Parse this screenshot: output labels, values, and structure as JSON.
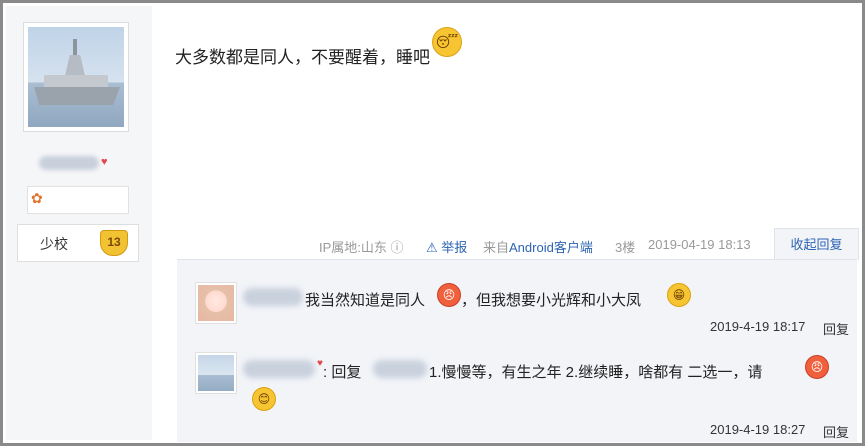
{
  "post": {
    "text": "大多数都是同人，不要醒着，睡吧",
    "ip_label": "IP属地:山东",
    "report_label": "举报",
    "client_prefix": "来自",
    "client_name": "Android客户端",
    "floor": "3楼",
    "timestamp": "2019-04-19 18:13",
    "collapse_label": "收起回复"
  },
  "user": {
    "rank_label": "少校",
    "level": "13"
  },
  "replies": [
    {
      "text_a": "我当然知道是同人",
      "text_b": "，但我想要小光辉和小大凤",
      "time": "2019-4-19 18:17",
      "reply_label": "回复"
    },
    {
      "reply_prefix": ": 回复",
      "text": "1.慢慢等，有生之年 2.继续睡，啥都有 二选一，请",
      "time": "2019-4-19 18:27",
      "reply_label": "回复"
    }
  ],
  "icons": {
    "sleep_emoji": "sleeping-face-icon",
    "help": "question-circle-icon",
    "warning": "warning-triangle-icon"
  },
  "colors": {
    "link": "#2d64b3",
    "sidebar_bg": "#f5f6f8",
    "reply_bg": "#f2f4f8"
  }
}
